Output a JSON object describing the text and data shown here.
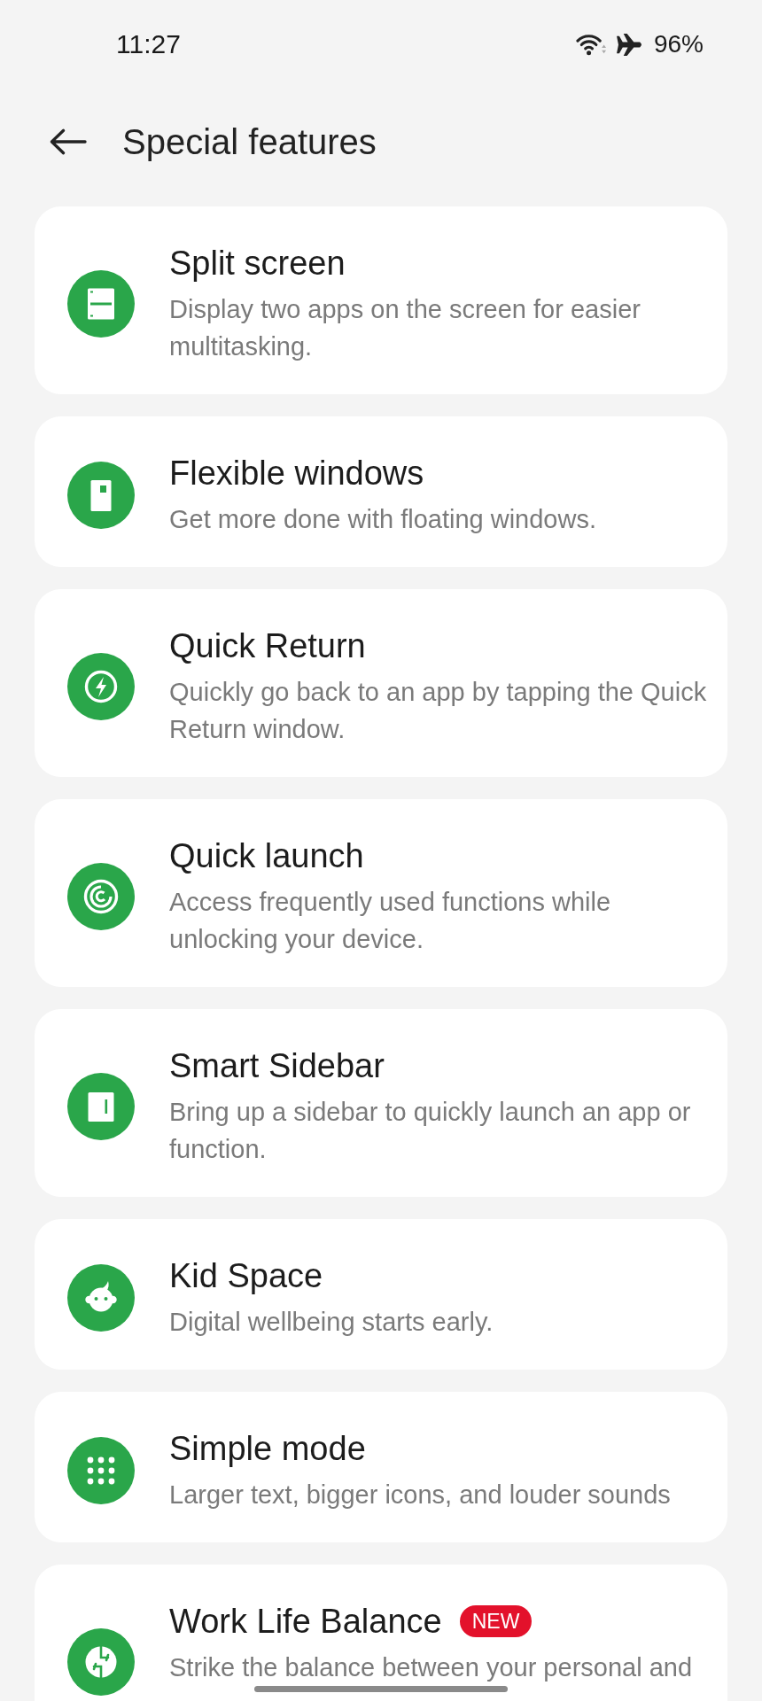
{
  "status_bar": {
    "time": "11:27",
    "wifi_connected": true,
    "airplane_mode": true,
    "battery": "96%"
  },
  "header": {
    "title": "Special features"
  },
  "features": [
    {
      "title": "Split screen",
      "description": "Display two apps on the screen for easier multitasking."
    },
    {
      "title": "Flexible windows",
      "description": "Get more done with floating windows."
    },
    {
      "title": "Quick Return",
      "description": "Quickly go back to an app by tapping the Quick Return window."
    },
    {
      "title": "Quick launch",
      "description": "Access frequently used functions while unlocking your device."
    },
    {
      "title": "Smart Sidebar",
      "description": "Bring up a sidebar to quickly launch an app or function."
    },
    {
      "title": "Kid Space",
      "description": "Digital wellbeing starts early."
    },
    {
      "title": "Simple mode",
      "description": "Larger text, bigger icons, and louder sounds"
    },
    {
      "title": "Work Life Balance",
      "badge": "NEW",
      "description": "Strike the balance between your personal and"
    }
  ]
}
